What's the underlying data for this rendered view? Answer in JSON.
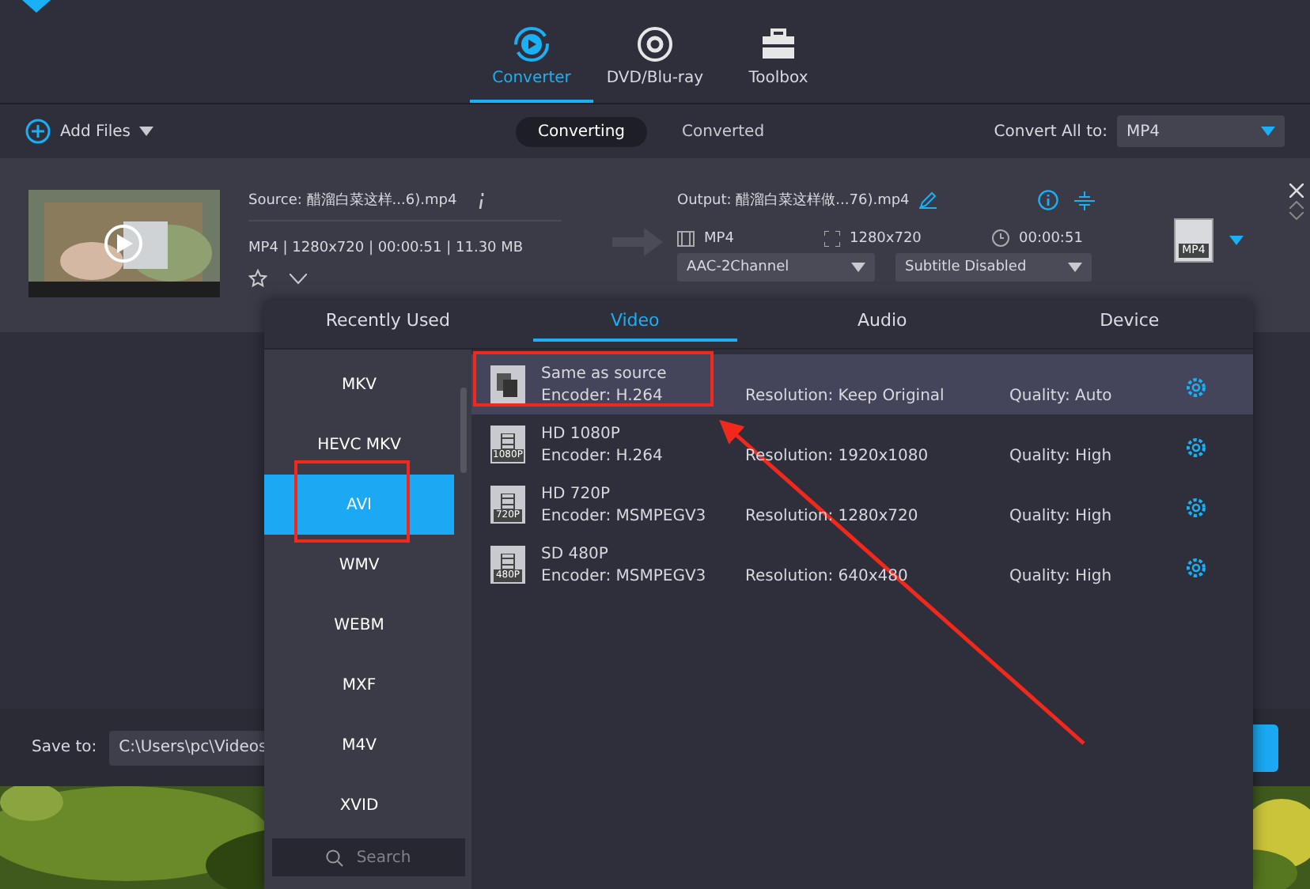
{
  "nav_tabs": [
    {
      "label": "Converter",
      "selected": true
    },
    {
      "label": "DVD/Blu-ray",
      "selected": false
    },
    {
      "label": "Toolbox",
      "selected": false
    }
  ],
  "toolbar": {
    "add_files": "Add Files",
    "modes": [
      {
        "label": "Converting",
        "selected": true
      },
      {
        "label": "Converted",
        "selected": false
      }
    ],
    "convert_all_label": "Convert All to:",
    "convert_all_value": "MP4"
  },
  "file": {
    "source": "Source: 醋溜白菜这样...6).mp4",
    "source_info": "MP4 | 1280x720 | 00:00:51 | 11.30 MB",
    "output": "Output: 醋溜白菜这样做...76).mp4",
    "out_format": "MP4",
    "out_resolution": "1280x720",
    "out_duration": "00:00:51",
    "audio": "AAC-2Channel",
    "subtitle": "Subtitle Disabled",
    "format_badge": "MP4"
  },
  "format_popup": {
    "tabs": [
      {
        "label": "Recently Used",
        "selected": false
      },
      {
        "label": "Video",
        "selected": true
      },
      {
        "label": "Audio",
        "selected": false
      },
      {
        "label": "Device",
        "selected": false
      }
    ],
    "formats": [
      {
        "label": "MKV",
        "selected": false
      },
      {
        "label": "HEVC MKV",
        "selected": false
      },
      {
        "label": "AVI",
        "selected": true
      },
      {
        "label": "WMV",
        "selected": false
      },
      {
        "label": "WEBM",
        "selected": false
      },
      {
        "label": "MXF",
        "selected": false
      },
      {
        "label": "M4V",
        "selected": false
      },
      {
        "label": "XVID",
        "selected": false
      }
    ],
    "search_placeholder": "Search",
    "presets": [
      {
        "kind": "source",
        "title": "Same as source",
        "encoder": "Encoder: H.264",
        "resolution": "Resolution: Keep Original",
        "quality": "Quality: Auto",
        "selected": true
      },
      {
        "kind": "film",
        "badge": "1080P",
        "title": "HD 1080P",
        "encoder": "Encoder: H.264",
        "resolution": "Resolution: 1920x1080",
        "quality": "Quality: High",
        "selected": false
      },
      {
        "kind": "film",
        "badge": "720P",
        "title": "HD 720P",
        "encoder": "Encoder: MSMPEGV3",
        "resolution": "Resolution: 1280x720",
        "quality": "Quality: High",
        "selected": false
      },
      {
        "kind": "film",
        "badge": "480P",
        "title": "SD 480P",
        "encoder": "Encoder: MSMPEGV3",
        "resolution": "Resolution: 640x480",
        "quality": "Quality: High",
        "selected": false
      }
    ]
  },
  "save_bar": {
    "label": "Save to:",
    "path": "C:\\Users\\pc\\Videos"
  }
}
